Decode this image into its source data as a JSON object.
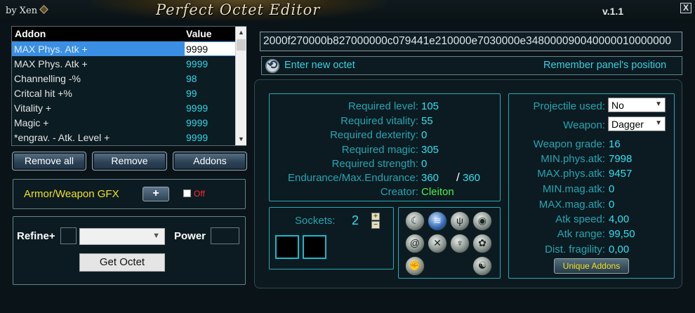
{
  "titlebar": {
    "author": "by Xen",
    "title": "Perfect Octet Editor",
    "version": "v.1.1",
    "close_label": "X"
  },
  "addons": {
    "header": {
      "name": "Addon",
      "value": "Value"
    },
    "rows": [
      {
        "name": "MAX Phys. Atk +",
        "value": "9999",
        "selected": true
      },
      {
        "name": "MAX Phys. Atk +",
        "value": "9999"
      },
      {
        "name": "Channelling -%",
        "value": "98"
      },
      {
        "name": "Critcal hit +%",
        "value": "99"
      },
      {
        "name": "Vitality +",
        "value": "9999"
      },
      {
        "name": "Magic +",
        "value": "9999"
      },
      {
        "name": "*engrav. - Atk. Level +",
        "value": "9999"
      }
    ]
  },
  "buttons": {
    "remove_all": "Remove all",
    "remove": "Remove",
    "addons": "Addons",
    "get_octet": "Get Octet",
    "unique_addons": "Unique Addons"
  },
  "gfx": {
    "label": "Armor/Weapon GFX",
    "plus": "+",
    "toggle": "Off"
  },
  "refine": {
    "label": "Refine+",
    "power_label": "Power"
  },
  "octet": {
    "value": "2000f270000b827000000c079441e210000e7030000e348000090040000010000000",
    "enter_label": "Enter new octet",
    "remember_label": "Remember panel's position"
  },
  "requirements": {
    "level_label": "Required level:",
    "level": "105",
    "vitality_label": "Required vitality:",
    "vitality": "55",
    "dexterity_label": "Required dexterity:",
    "dexterity": "0",
    "magic_label": "Required magic:",
    "magic": "305",
    "strength_label": "Required strength:",
    "strength": "0",
    "endurance_label": "Endurance/Max.Endurance:",
    "endurance": "360",
    "max_endurance": "360",
    "slash": "/",
    "creator_label": "Creator:",
    "creator": "Cleiton"
  },
  "sockets": {
    "label": "Sockets:",
    "count": "2",
    "plus": "+",
    "minus": "−"
  },
  "weapon": {
    "projectile_label": "Projectile used:",
    "projectile": "No",
    "weapon_label": "Weapon:",
    "weapon": "Dagger",
    "grade_label": "Weapon grade:",
    "grade": "16",
    "min_phys_label": "MIN.phys.atk:",
    "min_phys": "7998",
    "max_phys_label": "MAX.phys.atk:",
    "max_phys": "9457",
    "min_mag_label": "MIN.mag.atk:",
    "min_mag": "0",
    "max_mag_label": "MAX.mag.atk:",
    "max_mag": "0",
    "speed_label": "Atk speed:",
    "speed": "4,00",
    "range_label": "Atk range:",
    "range": "99,50",
    "fragility_label": "Dist. fragility:",
    "fragility": "0,00"
  },
  "icons": [
    "moon-icon",
    "blue-wave-icon",
    "claw-icon",
    "orb-icon",
    "swirl-icon",
    "crossed-blades-icon",
    "mask-icon",
    "lotus-icon",
    "fist-icon",
    "yin-yang-icon"
  ]
}
